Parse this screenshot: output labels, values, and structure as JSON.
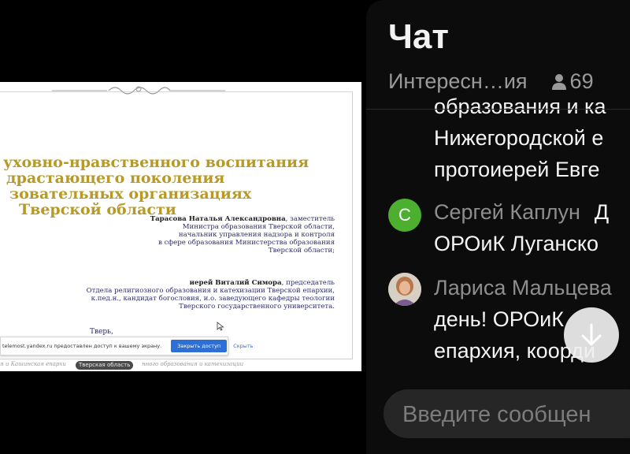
{
  "slide": {
    "title_lines": [
      "уховно-нравственного воспитания",
      "драстающего поколения",
      "зовательных организациях",
      "Тверской области"
    ],
    "author_name": "Тарасова Наталья Александровна",
    "author_rest": ", заместитель",
    "author_lines": [
      "Министра образования Тверской области,",
      "начальник управления надзора и контроля",
      "в сфере образования Министерства образования",
      "Тверской области;"
    ],
    "priest_name": "иерей Виталий Симора",
    "priest_rest": ", председатель",
    "priest_lines": [
      "Отдела религиозного образования и катехизации Тверской епархии,",
      "к.пед.н., кандидат богословия, и.о. заведующего кафедры теологии",
      "Тверского государственного университета."
    ],
    "city": "Тверь,",
    "footer_text": "я и Кашинская епархи",
    "footer_tag": "Тверская область",
    "footer_text2": "нного образования и катехизации"
  },
  "share_bar": {
    "text": "telemost.yandex.ru предоставлен доступ к вашему экрану.",
    "share_label": "Закрыть доступ",
    "hide_label": "Скрыть"
  },
  "chat": {
    "title": "Чат",
    "subtitle": "Интересн…ия",
    "participants": "69",
    "messages": [
      {
        "lines": [
          "образования и ка",
          "Нижегородской е",
          "протоиерей Евге"
        ]
      },
      {
        "avatar_letter": "С",
        "author": "Сергей Каплун",
        "author_tail": "Д",
        "lines": [
          "ОРОиК Луганско"
        ]
      },
      {
        "author": "Лариса Мальцева",
        "lines": [
          "день! ОРОиК",
          "епархия, коорди"
        ]
      }
    ],
    "input_placeholder": "Введите сообщен",
    "colors": {
      "avatar_green": "#4caf2f",
      "panel_bg": "#0c0c0c",
      "slide_title": "#b79a24"
    },
    "icons": {
      "participants": "person-icon",
      "scroll": "arrow-down-icon"
    }
  }
}
